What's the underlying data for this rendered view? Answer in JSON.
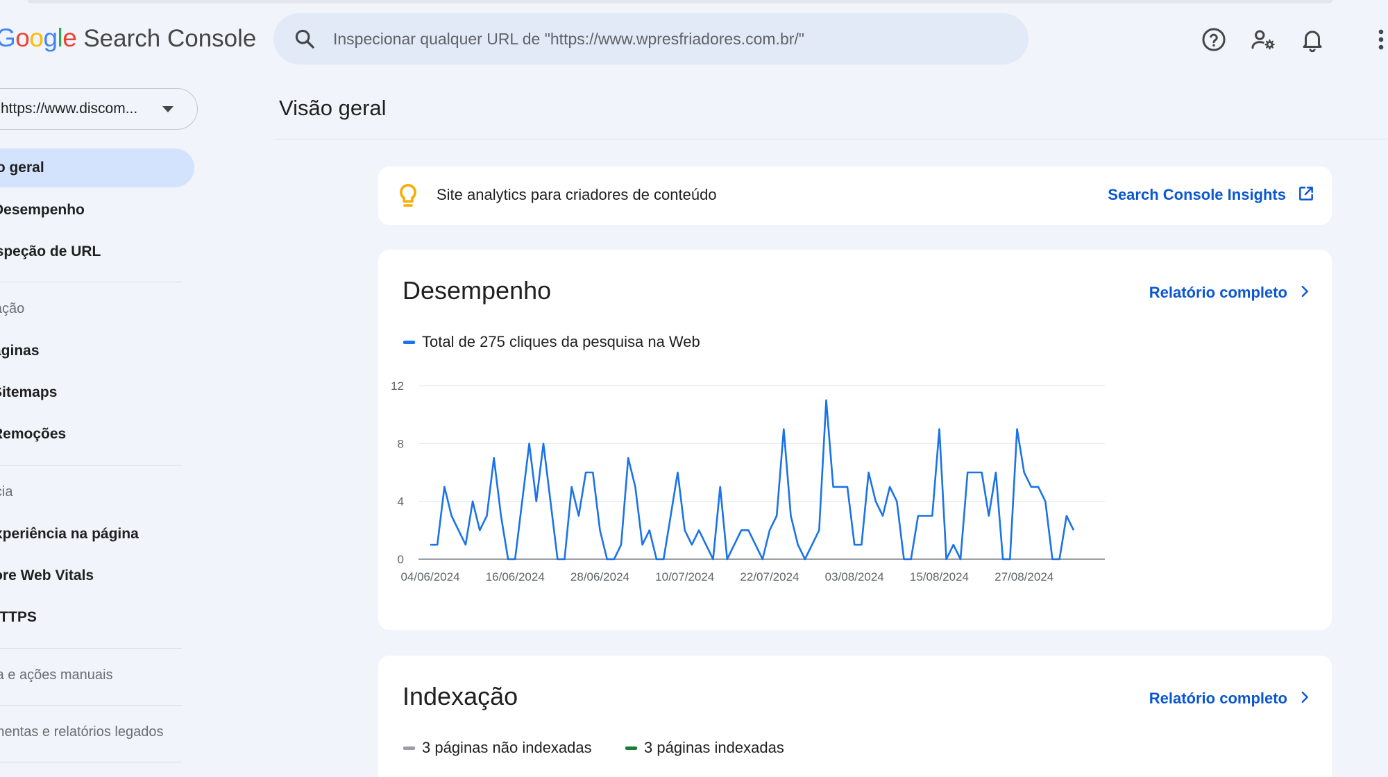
{
  "app": {
    "logo_letters": [
      {
        "ch": "G",
        "color": "#4285f4"
      },
      {
        "ch": "o",
        "color": "#ea4335"
      },
      {
        "ch": "o",
        "color": "#fbbc05"
      },
      {
        "ch": "g",
        "color": "#4285f4"
      },
      {
        "ch": "l",
        "color": "#34a853"
      },
      {
        "ch": "e",
        "color": "#ea4335"
      }
    ],
    "product": "Search Console"
  },
  "search": {
    "placeholder": "Inspecionar qualquer URL de \"https://www.wpresfriadores.com.br/\""
  },
  "header_icons": [
    "help-icon",
    "manage-users-icon",
    "notifications-icon",
    "more-vert-icon"
  ],
  "sidebar": {
    "property": "https://www.discom...",
    "items": [
      {
        "label": "Visão geral",
        "active": true
      },
      {
        "label": "Desempenho"
      },
      {
        "label": "Inspeção de URL"
      }
    ],
    "sections": [
      {
        "heading": "Indexação",
        "items": [
          "Páginas",
          "Sitemaps",
          "Remoções"
        ]
      },
      {
        "heading": "Experiência",
        "items": [
          "Experiência na página",
          "Core Web Vitals",
          "HTTPS"
        ]
      },
      {
        "heading": "Segurança e ações manuais",
        "items": []
      },
      {
        "heading": "Ferramentas e relatórios legados",
        "items": []
      }
    ]
  },
  "main": {
    "title": "Visão geral",
    "banner": {
      "text": "Site analytics para criadores de conteúdo",
      "link": "Search Console Insights"
    },
    "performance": {
      "title": "Desempenho",
      "link": "Relatório completo",
      "legend": "Total de 275 cliques da pesquisa na Web"
    },
    "indexing": {
      "title": "Indexação",
      "link": "Relatório completo",
      "legend_not_indexed": "3 páginas não indexadas",
      "legend_indexed": "3 páginas indexadas"
    }
  },
  "colors": {
    "accent": "#0b57d0",
    "series": "#1a73e8",
    "not_indexed": "#9aa0a6",
    "indexed": "#188038",
    "active_nav": "#d3e3fd"
  },
  "chart_data": {
    "type": "line",
    "x_start": "04/06/2024",
    "x_ticks": [
      "04/06/2024",
      "16/06/2024",
      "28/06/2024",
      "10/07/2024",
      "22/07/2024",
      "03/08/2024",
      "15/08/2024",
      "27/08/2024"
    ],
    "y_ticks": [
      0,
      4,
      8,
      12
    ],
    "ylim": [
      0,
      12
    ],
    "series": [
      {
        "name": "Total de 275 cliques da pesquisa na Web",
        "values": [
          1,
          1,
          5,
          3,
          2,
          1,
          4,
          2,
          3,
          7,
          3,
          0,
          0,
          4,
          8,
          4,
          8,
          4,
          0,
          0,
          5,
          3,
          6,
          6,
          2,
          0,
          0,
          1,
          7,
          5,
          1,
          2,
          0,
          0,
          3,
          6,
          2,
          1,
          2,
          1,
          0,
          5,
          0,
          1,
          2,
          2,
          1,
          0,
          2,
          3,
          9,
          3,
          1,
          0,
          1,
          2,
          11,
          5,
          5,
          5,
          1,
          1,
          6,
          4,
          3,
          5,
          4,
          0,
          0,
          3,
          3,
          3,
          9,
          0,
          1,
          0,
          6,
          6,
          6,
          3,
          6,
          0,
          0,
          9,
          6,
          5,
          5,
          4,
          0,
          0,
          3,
          2
        ]
      }
    ]
  }
}
